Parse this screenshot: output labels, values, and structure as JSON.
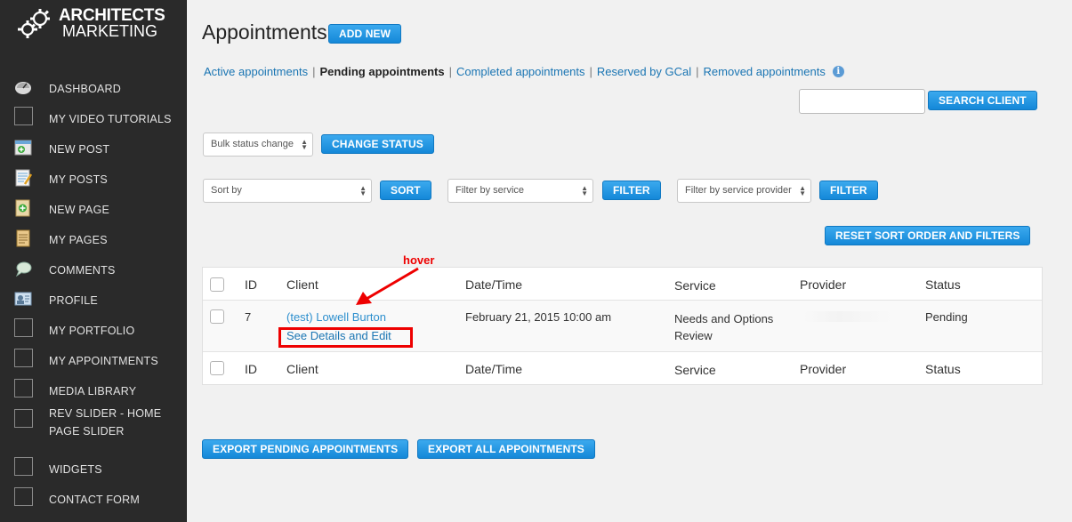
{
  "brand": {
    "line1": "ARCHITECTS",
    "line2": "MARKETING"
  },
  "sidebar": {
    "items": [
      {
        "label": "DASHBOARD",
        "icon": "dashboard-icon"
      },
      {
        "label": "MY VIDEO TUTORIALS",
        "icon": "blank-icon"
      },
      {
        "label": "NEW POST",
        "icon": "new-post-icon"
      },
      {
        "label": "MY POSTS",
        "icon": "posts-icon"
      },
      {
        "label": "NEW PAGE",
        "icon": "new-page-icon"
      },
      {
        "label": "MY PAGES",
        "icon": "pages-icon"
      },
      {
        "label": "COMMENTS",
        "icon": "comments-icon"
      },
      {
        "label": "PROFILE",
        "icon": "profile-icon"
      },
      {
        "label": "MY PORTFOLIO",
        "icon": "blank-icon"
      },
      {
        "label": "MY APPOINTMENTS",
        "icon": "blank-icon"
      },
      {
        "label": "MEDIA LIBRARY",
        "icon": "blank-icon"
      },
      {
        "label": "REV SLIDER - HOME PAGE SLIDER",
        "icon": "blank-icon"
      },
      {
        "label": "WIDGETS",
        "icon": "blank-icon"
      },
      {
        "label": "CONTACT FORM",
        "icon": "blank-icon"
      }
    ]
  },
  "header": {
    "title": "Appointments",
    "add_new": "ADD NEW"
  },
  "tabs": [
    {
      "label": "Active appointments",
      "current": false
    },
    {
      "label": "Pending appointments",
      "current": true
    },
    {
      "label": "Completed appointments",
      "current": false
    },
    {
      "label": "Reserved by GCal",
      "current": false
    },
    {
      "label": "Removed appointments",
      "current": false
    }
  ],
  "search": {
    "value": "",
    "button": "SEARCH CLIENT"
  },
  "bulk": {
    "selected": "Bulk status change",
    "button": "CHANGE STATUS"
  },
  "filters": {
    "sort_selected": "Sort by",
    "sort_button": "SORT",
    "service_selected": "Filter by service",
    "service_button": "FILTER",
    "provider_selected": "Filter by service provider",
    "provider_button": "FILTER",
    "reset_button": "RESET SORT ORDER AND FILTERS"
  },
  "table": {
    "columns": [
      "ID",
      "Client",
      "Date/Time",
      "Service",
      "Provider",
      "Status"
    ],
    "rows": [
      {
        "id": "7",
        "client": "(test) Lowell Burton",
        "action": "See Details and Edit",
        "datetime": "February 21, 2015 10:00 am",
        "service": "Needs and Options Review",
        "provider": "",
        "status": "Pending"
      }
    ]
  },
  "annotation": {
    "label": "hover",
    "color": "#ee0000"
  },
  "export": {
    "pending": "EXPORT PENDING APPOINTMENTS",
    "all": "EXPORT ALL APPOINTMENTS"
  },
  "colors": {
    "accent": "#1488d8",
    "sidebar": "#2a2a2a",
    "link": "#1a75b3"
  }
}
